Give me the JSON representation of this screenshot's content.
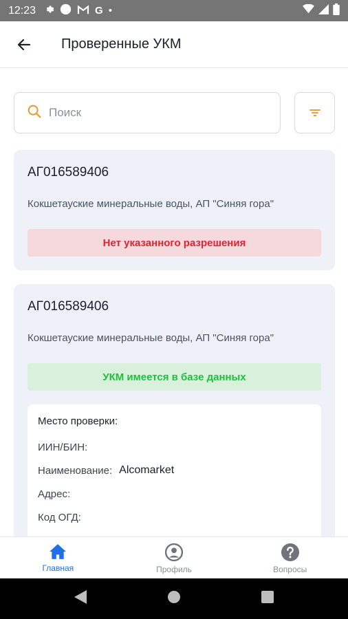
{
  "status_bar": {
    "time": "12:23",
    "icons": [
      "gear-icon",
      "circle-icon",
      "gmail-icon",
      "google-icon",
      "dot-icon"
    ],
    "right_icons": [
      "wifi-icon",
      "signal-icon",
      "battery-icon"
    ]
  },
  "app_bar": {
    "title": "Проверенные УКМ"
  },
  "search": {
    "placeholder": "Поиск",
    "value": ""
  },
  "cards": [
    {
      "code": "АГ016589406",
      "description": "Кокшетауские минеральные воды, АП \"Синяя гора\"",
      "status_text": "Нет указанного разрешения",
      "status": "error"
    },
    {
      "code": "АГ016589406",
      "description": "Кокшетауские минеральные воды, АП \"Синяя гора\"",
      "status_text": "УКМ имеется в базе данных",
      "status": "success",
      "details": {
        "heading": "Место проверки:",
        "rows": [
          {
            "label": "ИИН/БИН:",
            "value": ""
          },
          {
            "label": "Наименование:",
            "value": "Alcomarket"
          },
          {
            "label": "Адрес:",
            "value": ""
          },
          {
            "label": "Код ОГД:",
            "value": ""
          }
        ]
      }
    }
  ],
  "bottom_nav": {
    "items": [
      {
        "label": "Главная",
        "icon": "home-icon",
        "active": true
      },
      {
        "label": "Профиль",
        "icon": "profile-icon",
        "active": false
      },
      {
        "label": "Вопросы",
        "icon": "help-icon",
        "active": false
      }
    ]
  },
  "colors": {
    "accent": "#1e6fe8",
    "error_text": "#e0242f",
    "error_bg": "#f6d9dd",
    "success_text": "#1fbf3b",
    "success_bg": "#d9f0dd",
    "search_icon": "#e3a33a",
    "card_bg": "#eef2f8"
  }
}
